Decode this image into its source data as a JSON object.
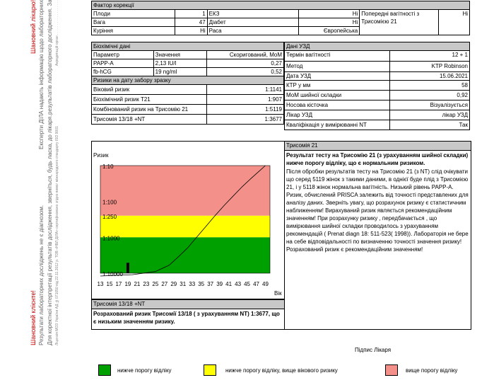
{
  "side_text": {
    "doctor_title": "Шановний лікарю!",
    "doctor_line1": "Експерти ДІЛА надають інформацію щодо лабораторних",
    "doctor_line2": "результатів лабораторного дослідження. За інформацією",
    "doctor_line3": "Акредитацій орган . . . . . . . . . . . . . . . . . .",
    "client_title": "Шановний клієнте!",
    "client_line1": "Результати лабораторних досліджень не є діагнозом.",
    "client_line2": "Для коректної інтерпретації результатів дослідження, зверніться, будь ласка, до лікаря.",
    "client_line3": "Ліцензія МОЗ України АД №071050 від 22.11.2012 р. ТОВ «НВЛ ДІЛА» сертифіковано згідно вимог міжнародного стандарту ISO 9001"
  },
  "correction": {
    "header": "Фактор корекції",
    "rows": [
      {
        "label": "Плоди",
        "value": "1",
        "label2": "ЕКЗ",
        "value2": "Ні"
      },
      {
        "label": "Вага",
        "value": "47",
        "label2": "Діабет",
        "value2": "Ні"
      },
      {
        "label": "Куріння",
        "value": "Ні",
        "label2": "Раса",
        "value2": "Європейська"
      }
    ],
    "prev_label": "Попередні вагітності з Трисомією 21",
    "prev_value": "Ні"
  },
  "biochem": {
    "header": "Біохімічні дані",
    "col_param": "Параметр",
    "col_value": "Значення",
    "col_mom": "Скоригований, MoM",
    "rows": [
      {
        "param": "PAPP-A",
        "value": "2,13 IU/l",
        "mom": "0,27"
      },
      {
        "param": "fb-hCG",
        "value": "19 ng/ml",
        "mom": "0,52"
      }
    ]
  },
  "uzd": {
    "header": "Дані УЗД",
    "rows": [
      {
        "label": "Термін вагітності",
        "value": "12 + 1"
      },
      {
        "label": "Метод",
        "value": "KTP Robinson"
      },
      {
        "label": "Дата УЗД",
        "value": "15.06.2021"
      },
      {
        "label": "КТР у мм",
        "value": "58"
      },
      {
        "label": "МоМ шийної складки",
        "value": "0,92"
      },
      {
        "label": "Носова кісточка",
        "value": "Візуалізується"
      },
      {
        "label": "Лікар УЗД",
        "value": "лікар УЗД"
      },
      {
        "label": "Кваліфікація у вимірюванні NT",
        "value": "Так"
      }
    ]
  },
  "risks": {
    "header": "Ризики на дату забору зразку",
    "rows": [
      {
        "label": "Віковий ризик",
        "value": "1:1141"
      },
      {
        "label": "Біохімічний ризик T21",
        "value": "1:907"
      },
      {
        "label": "Комбінований ризик на Трисомію 21",
        "value": "1:5119"
      },
      {
        "label": "Трисомія 13/18 +NT",
        "value": "1:3677"
      }
    ]
  },
  "chart_data": {
    "type": "area",
    "title": "Ризик",
    "xlabel": "Вік",
    "ylabel": "",
    "x_ticks": [
      "13",
      "15",
      "17",
      "19",
      "21",
      "23",
      "25",
      "27",
      "29",
      "31",
      "33",
      "35",
      "37",
      "39",
      "41",
      "43",
      "45",
      "47",
      "49"
    ],
    "y_ticks": [
      "1:10",
      "1:100",
      "1:250",
      "1:1000",
      "1:10000"
    ],
    "xlim": [
      13,
      50
    ],
    "zones": [
      {
        "name": "red",
        "from_risk": "1:10",
        "to_risk": "1:250",
        "color": "#f4908a"
      },
      {
        "name": "yellow",
        "from_risk": "1:250",
        "to_risk": "1:1000",
        "color": "#ffff00"
      },
      {
        "name": "green",
        "from_risk": "1:1000",
        "to_risk": "1:10000",
        "color": "#00a000"
      }
    ],
    "patient_age": 19,
    "patient_risk": "1:5119",
    "curve": {
      "x": [
        13,
        20,
        25,
        28,
        30,
        32,
        34,
        36,
        38,
        40,
        42,
        44,
        46,
        48,
        49
      ],
      "y": [
        12000,
        11000,
        9000,
        6000,
        3500,
        2000,
        1000,
        500,
        250,
        130,
        70,
        38,
        22,
        13,
        10
      ]
    }
  },
  "t1318": {
    "header": "Трисомія 13/18 +NT",
    "text": "Розрахований ризик Трисомії 13/18 ( з урахуванням NT) 1:3677, що є низьким значенням ризику."
  },
  "t21": {
    "header": "Трисомія 21",
    "bold_text": "Результат тесту на Трисомію 21 (з урахуванням шийної складки) нижче порогу відліку, що є нормальним ризиком.",
    "text": "Після обробки результатів тесту на Трисомію 21 (з NT) слід очікувати що серед 5119 жінок з такими даними, в однієї буде плід з Трисомією 21, і у 5118 жінок нормальна вагітність. Низький рівень PAPP-A. Ризик, обчислений PRISCA залежить від точності представлених для аналізу даних. Зверніть увагу, що розрахунок ризику є статистичним наближенням! Вирахуваний ризик являється рекомендаційним значенням! При розрахунку ризику , передбачається , що вимірювання шийної складки проводилось з урахуванням рекомендацій ( Prenat diagn 18: 511-523( 1998)). Лабораторія не бере на себе відповідальності по визначенню точності значення ризику! Розрахований ризик є рекомендаційним значенням!"
  },
  "signature": "Підпис Лікаря",
  "legend": [
    {
      "color": "#00a000",
      "label": "нижче порогу відліку"
    },
    {
      "color": "#ffff00",
      "label": "нижче порогу відліку, вище вікового ризику"
    },
    {
      "color": "#f4908a",
      "label": "вище порогу відліку"
    }
  ]
}
